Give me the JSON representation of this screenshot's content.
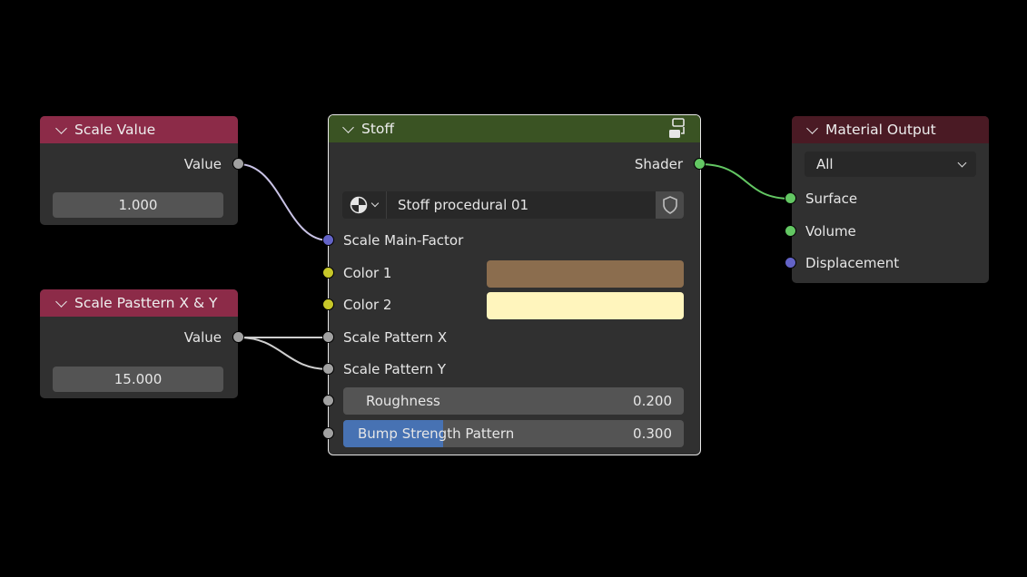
{
  "nodes": {
    "scale_value": {
      "title": "Scale Value",
      "output_label": "Value",
      "value": "1.000"
    },
    "scale_pattern": {
      "title": "Scale Pasttern X & Y",
      "output_label": "Value",
      "value": "15.000"
    },
    "stoff": {
      "title": "Stoff",
      "output_label": "Shader",
      "datablock_name": "Stoff procedural 01",
      "inputs": {
        "scale_main": "Scale Main-Factor",
        "color1": "Color 1",
        "color2": "Color 2",
        "scale_x": "Scale Pattern X",
        "scale_y": "Scale Pattern Y",
        "roughness_label": "Roughness",
        "roughness_value": "0.200",
        "bump_label": "Bump Strength Pattern",
        "bump_value": "0.300"
      },
      "color1_hex": "#8b6d4e",
      "color2_hex": "#fff5bd",
      "roughness_fraction": 0.2,
      "bump_fraction": 0.3
    },
    "material_output": {
      "title": "Material Output",
      "target": "All",
      "inputs": {
        "surface": "Surface",
        "volume": "Volume",
        "displacement": "Displacement"
      }
    }
  },
  "colors": {
    "header_input": "#8c2b48",
    "header_group": "#3a5323",
    "header_output": "#4a1a24",
    "socket_float": "#a1a1a1",
    "socket_vector": "#6363c7",
    "socket_color": "#c7c729",
    "socket_shader": "#63c763"
  },
  "icons": {
    "collapse": "chevron-down-icon",
    "node_group": "node-group-icon",
    "datablock": "material-sphere-icon",
    "fake_user": "shield-icon"
  }
}
